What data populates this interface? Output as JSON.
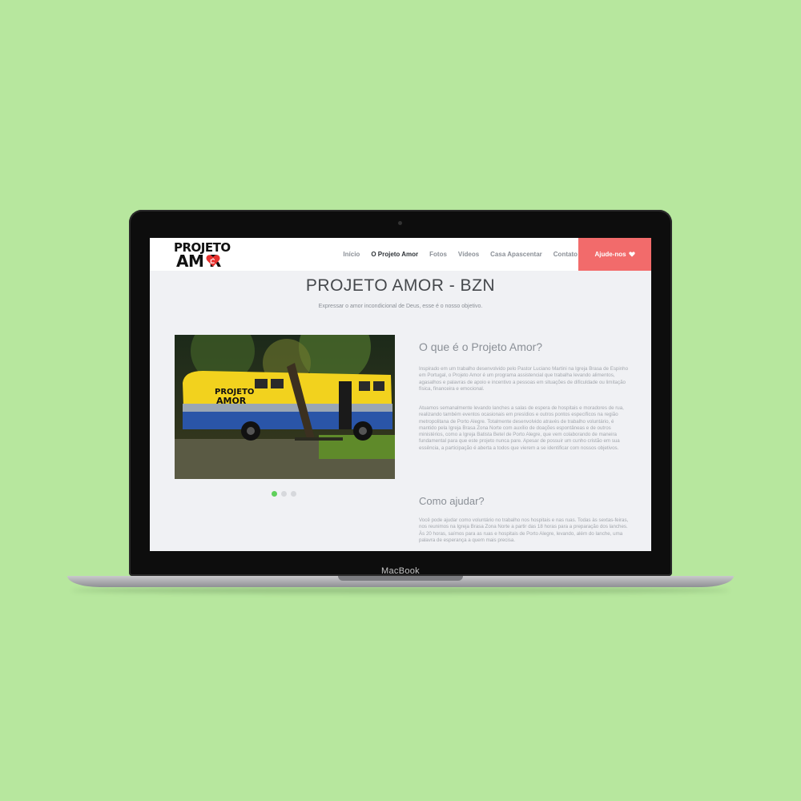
{
  "device": {
    "label": "MacBook"
  },
  "site": {
    "logo": {
      "line1": "PROJETO",
      "line2": "AM  R"
    },
    "nav": {
      "items": [
        {
          "label": "Início",
          "active": false
        },
        {
          "label": "O Projeto Amor",
          "active": true
        },
        {
          "label": "Fotos",
          "active": false
        },
        {
          "label": "Vídeos",
          "active": false
        },
        {
          "label": "Casa Apascentar",
          "active": false
        },
        {
          "label": "Contato",
          "active": false
        }
      ],
      "cta_label": "Ajude-nos",
      "cta_icon": "heart-icon"
    },
    "hero": {
      "title": "PROJETO AMOR - BZN",
      "subtitle": "Expressar o amor incondicional de Deus, esse é o nosso objetivo."
    },
    "carousel": {
      "slides": 3,
      "active_index": 0,
      "bus_logo_line1": "PROJETO",
      "bus_logo_line2": "AMOR"
    },
    "section1": {
      "heading": "O que é o Projeto Amor?",
      "paragraph1": "Inspirado em um trabalho desenvolvido pelo Pastor Luciano Martini na Igreja Brasa de Espinho em Portugal, o Projeto Amor é um programa assistencial que trabalha levando alimentos, agasalhos e palavras de apoio e incentivo a pessoas em situações de dificuldade ou limitação física, financeira e emocional.",
      "paragraph2": "Atuamos semanalmente levando lanches a salas de espera de hospitais e moradores de rua, realizando também eventos ocasionais em presídios e outros pontos específicos na região metropolitana de Porto Alegre. Totalmente desenvolvido através de trabalho voluntário, é mantido pela Igreja Brasa Zona Norte com auxílio de doações espontâneas e de outros ministérios, como a Igreja Batista Betel de Porto Alegre, que vem colaborando de maneira fundamental para que este projeto nunca pare. Apesar de possuir um cunho cristão em sua essência, a participação é aberta a todos que vierem a se identificar com nossos objetivos."
    },
    "section2": {
      "heading": "Como ajudar?",
      "paragraph1": "Você pode ajudar como voluntário no trabalho nos hospitais e nas ruas. Todas às sextas-feiras, nos reunimos na Igreja Brasa Zona Norte a partir das 18 horas para a preparação dos lanches. Às 20 horas, saímos para as ruas e hospitais de Porto Alegre, levando, além do lanche, uma palavra de esperança a quem mais precisa."
    },
    "colors": {
      "background": "#b7e79e",
      "accent": "#f26b6b",
      "dot_active": "#5fd05b"
    }
  }
}
